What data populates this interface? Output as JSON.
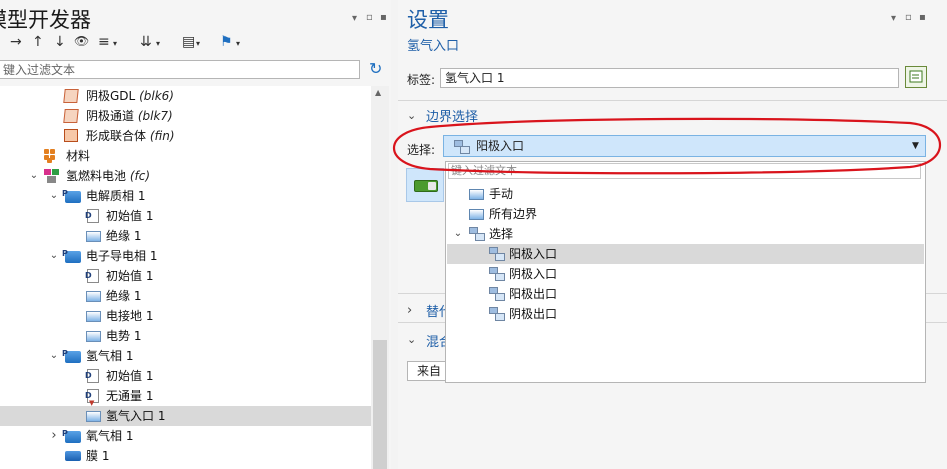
{
  "left_panel": {
    "title": "模型开发器",
    "ctl_menu": "▾",
    "ctl_restore": "▫",
    "ctl_pin": "▪",
    "toolbar": [
      "→",
      "↑",
      "↓",
      "👁",
      "≡",
      "⇊",
      "▤",
      "⚑"
    ],
    "toolbar_caret": "▾",
    "filter_placeholder": "键入过滤文本",
    "refresh_icon": "↻",
    "scroll_up": "▲",
    "tree": [
      {
        "label": "阴极GDL",
        "tag": "(blk6)"
      },
      {
        "label": "阴极通道",
        "tag": "(blk7)"
      },
      {
        "label": "形成联合体",
        "tag": "(fin)"
      },
      {
        "label": "材料",
        "tag": ""
      },
      {
        "label": "氢燃料电池",
        "tag": "(fc)"
      },
      {
        "label": "电解质相 1",
        "tag": ""
      },
      {
        "label": "初始值 1",
        "tag": ""
      },
      {
        "label": "绝缘 1",
        "tag": ""
      },
      {
        "label": "电子导电相 1",
        "tag": ""
      },
      {
        "label": "初始值 1",
        "tag": ""
      },
      {
        "label": "绝缘 1",
        "tag": ""
      },
      {
        "label": "电接地 1",
        "tag": ""
      },
      {
        "label": "电势 1",
        "tag": ""
      },
      {
        "label": "氢气相 1",
        "tag": ""
      },
      {
        "label": "初始值 1",
        "tag": ""
      },
      {
        "label": "无通量 1",
        "tag": ""
      },
      {
        "label": "氢气入口 1",
        "tag": ""
      },
      {
        "label": "氧气相 1",
        "tag": ""
      },
      {
        "label": "膜 1",
        "tag": ""
      }
    ],
    "twisty_open": "⌄",
    "twisty_closed": "›"
  },
  "right_panel": {
    "title": "设置",
    "subtitle": "氢气入口",
    "label_field_label": "标签:",
    "label_field_value": "氢气入口 1",
    "boundary_section_title": "边界选择",
    "selection_label": "选择:",
    "selection_value": "阳极入口",
    "section3_title": "替代",
    "section4_title": "混合",
    "from_button_label": "来自",
    "chev_open": "⌄",
    "chev_closed": "›",
    "combo_caret": "▼"
  },
  "dropdown": {
    "filter_placeholder": "键入过滤文本",
    "items": [
      {
        "label": "手动",
        "icon": "manual-icon"
      },
      {
        "label": "所有边界",
        "icon": "all-boundaries-icon"
      },
      {
        "label": "选择",
        "icon": "selection-group-icon"
      },
      {
        "label": "阳极入口",
        "icon": "selection-icon"
      },
      {
        "label": "阴极入口",
        "icon": "selection-icon"
      },
      {
        "label": "阳极出口",
        "icon": "selection-icon"
      },
      {
        "label": "阴极出口",
        "icon": "selection-icon"
      }
    ],
    "highlighted_index": 3
  },
  "annotation": {
    "color": "#d9141c"
  },
  "colors": {
    "accent": "#1f5fa8",
    "combo_bg": "#cfe6fb",
    "selected_row": "#d9d9d9"
  }
}
